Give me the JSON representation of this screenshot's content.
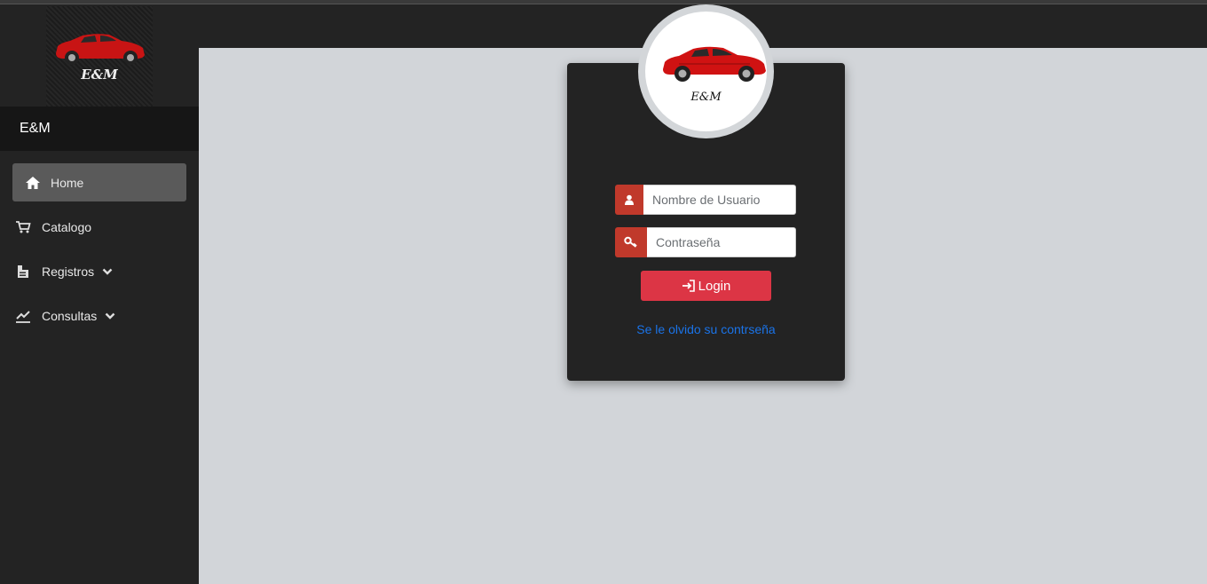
{
  "sidebar": {
    "logo_text": "E&M",
    "brand": "E&M",
    "items": [
      {
        "label": "Home",
        "icon": "home-icon",
        "active": true
      },
      {
        "label": "Catalogo",
        "icon": "cart-icon"
      },
      {
        "label": "Registros",
        "icon": "registry-icon",
        "dropdown": true
      },
      {
        "label": "Consultas",
        "icon": "chart-line-icon",
        "dropdown": true
      }
    ]
  },
  "login": {
    "avatar_text": "E&M",
    "username_placeholder": "Nombre de Usuario",
    "password_placeholder": "Contraseña",
    "login_label": "Login",
    "forgot_label": "Se le olvido su contrseña",
    "addon_color": "#c0392b",
    "button_color": "#dc3545",
    "link_color": "#1a73e8"
  }
}
